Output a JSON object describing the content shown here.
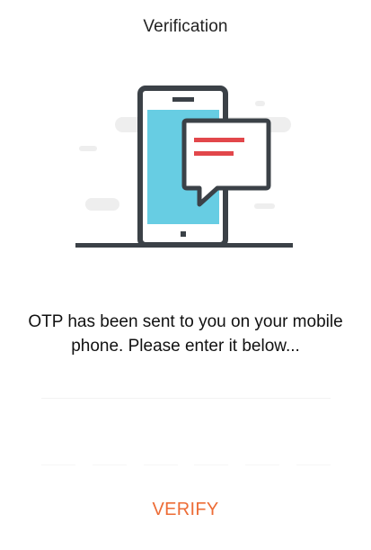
{
  "header": {
    "title": "Verification"
  },
  "illustration": {
    "icon": "phone-with-message-icon",
    "colors": {
      "outline": "#3b4147",
      "screen": "#67cde3",
      "message_lines": "#e2474b",
      "background_clouds": "#eeeeee"
    }
  },
  "message": {
    "text": "OTP has been sent to you on your mobile phone. Please enter it below..."
  },
  "otp": {
    "value": "",
    "placeholder": ""
  },
  "actions": {
    "verify_label": "VERIFY",
    "verify_color": "#ed6c36"
  }
}
